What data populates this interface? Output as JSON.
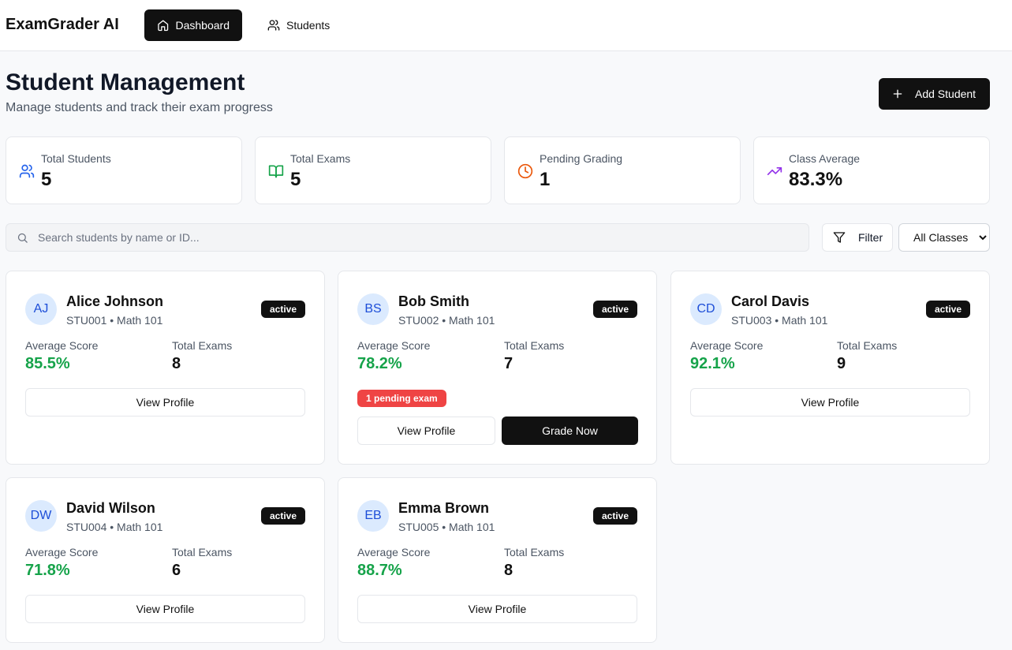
{
  "app": {
    "title": "ExamGrader AI"
  },
  "nav": {
    "dashboard": "Dashboard",
    "students": "Students"
  },
  "header": {
    "title": "Student Management",
    "subtitle": "Manage students and track their exam progress",
    "add_button": "Add Student"
  },
  "stats": [
    {
      "label": "Total Students",
      "value": "5",
      "icon": "users-icon",
      "color": "#2563eb"
    },
    {
      "label": "Total Exams",
      "value": "5",
      "icon": "book-open-icon",
      "color": "#16a34a"
    },
    {
      "label": "Pending Grading",
      "value": "1",
      "icon": "clock-icon",
      "color": "#ea580c"
    },
    {
      "label": "Class Average",
      "value": "83.3%",
      "icon": "trending-up-icon",
      "color": "#9333ea"
    }
  ],
  "search": {
    "placeholder": "Search students by name or ID...",
    "value": ""
  },
  "filter": {
    "label": "Filter"
  },
  "class_select": {
    "selected": "All Classes"
  },
  "labels": {
    "average_score": "Average Score",
    "total_exams": "Total Exams",
    "view_profile": "View Profile",
    "grade_now": "Grade Now"
  },
  "students": [
    {
      "initials": "AJ",
      "name": "Alice Johnson",
      "meta": "STU001 • Math 101",
      "status": "active",
      "average": "85.5%",
      "exams": "8",
      "pending": ""
    },
    {
      "initials": "BS",
      "name": "Bob Smith",
      "meta": "STU002 • Math 101",
      "status": "active",
      "average": "78.2%",
      "exams": "7",
      "pending": "1 pending exam"
    },
    {
      "initials": "CD",
      "name": "Carol Davis",
      "meta": "STU003 • Math 101",
      "status": "active",
      "average": "92.1%",
      "exams": "9",
      "pending": ""
    },
    {
      "initials": "DW",
      "name": "David Wilson",
      "meta": "STU004 • Math 101",
      "status": "active",
      "average": "71.8%",
      "exams": "6",
      "pending": ""
    },
    {
      "initials": "EB",
      "name": "Emma Brown",
      "meta": "STU005 • Math 101",
      "status": "active",
      "average": "88.7%",
      "exams": "8",
      "pending": ""
    }
  ]
}
